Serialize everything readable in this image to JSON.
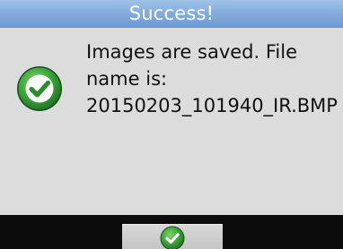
{
  "dialog": {
    "title": "Success!",
    "message_lines": [
      "Images are saved. File",
      "name is:",
      "20150203_101940_IR.BMP"
    ],
    "status_icon": "checkmark-circle-icon"
  },
  "buttons": {
    "confirm_icon": "checkmark-circle-icon"
  },
  "colors": {
    "title_bar": "#84acdc",
    "dialog_background": "#dcdcdc",
    "bottom_bar": "#0c0c0c",
    "check_green": "#3aa63a"
  }
}
